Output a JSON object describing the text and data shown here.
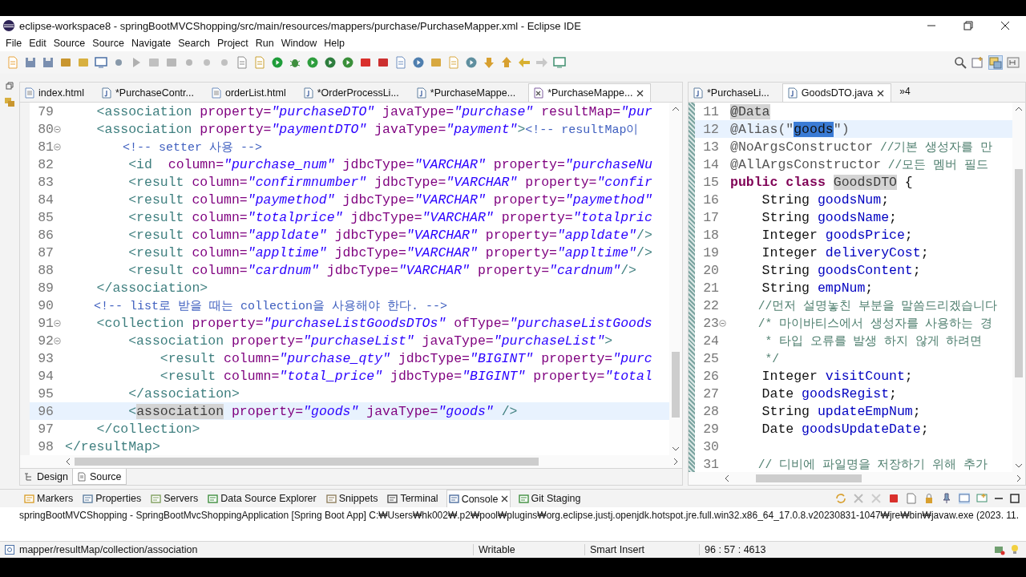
{
  "window": {
    "title": "eclipse-workspace8 - springBootMVCShopping/src/main/resources/mappers/purchase/PurchaseMapper.xml - Eclipse IDE"
  },
  "menu": [
    "File",
    "Edit",
    "Source",
    "Source",
    "Navigate",
    "Search",
    "Project",
    "Run",
    "Window",
    "Help"
  ],
  "editor_left": {
    "tabs": [
      {
        "label": "index.html",
        "kind": "html",
        "selected": false
      },
      {
        "label": "*PurchaseContr...",
        "kind": "java",
        "selected": false
      },
      {
        "label": "orderList.html",
        "kind": "html",
        "selected": false
      },
      {
        "label": "*OrderProcessLi...",
        "kind": "java",
        "selected": false
      },
      {
        "label": "*PurchaseMappe...",
        "kind": "java",
        "selected": false
      },
      {
        "label": "*PurchaseMappe...",
        "kind": "xml",
        "selected": true
      }
    ],
    "lines": [
      {
        "number": "79",
        "current": false,
        "fold": false,
        "tokens": [
          {
            "kind": "tag",
            "text": "    <association"
          },
          {
            "kind": "attr",
            "text": " property="
          },
          {
            "kind": "str",
            "text": "\"purchaseDTO\""
          },
          {
            "kind": "attr",
            "text": " javaType="
          },
          {
            "kind": "str",
            "text": "\"purchase\""
          },
          {
            "kind": "attr",
            "text": " resultMap="
          },
          {
            "kind": "str",
            "text": "\"pur"
          }
        ]
      },
      {
        "number": "80",
        "current": false,
        "fold": true,
        "tokens": [
          {
            "kind": "tag",
            "text": "    <association"
          },
          {
            "kind": "attr",
            "text": " property="
          },
          {
            "kind": "str",
            "text": "\"paymentDTO\""
          },
          {
            "kind": "attr",
            "text": " javaType="
          },
          {
            "kind": "str",
            "text": "\"payment\""
          },
          {
            "kind": "tag",
            "text": ">"
          },
          {
            "kind": "comment",
            "text": "<!-- resultMap이"
          }
        ]
      },
      {
        "number": "81",
        "current": false,
        "fold": true,
        "tokens": [
          {
            "kind": "comment",
            "text": "        <!-- setter 사용 -->"
          }
        ]
      },
      {
        "number": "82",
        "current": false,
        "fold": false,
        "tokens": [
          {
            "kind": "tag",
            "text": "        <id"
          },
          {
            "kind": "attr",
            "text": "  column="
          },
          {
            "kind": "str",
            "text": "\"purchase_num\""
          },
          {
            "kind": "attr",
            "text": " jdbcType="
          },
          {
            "kind": "str",
            "text": "\"VARCHAR\""
          },
          {
            "kind": "attr",
            "text": " property="
          },
          {
            "kind": "str",
            "text": "\"purchaseNu"
          }
        ]
      },
      {
        "number": "83",
        "current": false,
        "fold": false,
        "tokens": [
          {
            "kind": "tag",
            "text": "        <result"
          },
          {
            "kind": "attr",
            "text": " column="
          },
          {
            "kind": "str",
            "text": "\"confirmnumber\""
          },
          {
            "kind": "attr",
            "text": " jdbcType="
          },
          {
            "kind": "str",
            "text": "\"VARCHAR\""
          },
          {
            "kind": "attr",
            "text": " property="
          },
          {
            "kind": "str",
            "text": "\"confir"
          }
        ]
      },
      {
        "number": "84",
        "current": false,
        "fold": false,
        "tokens": [
          {
            "kind": "tag",
            "text": "        <result"
          },
          {
            "kind": "attr",
            "text": " column="
          },
          {
            "kind": "str",
            "text": "\"paymethod\""
          },
          {
            "kind": "attr",
            "text": " jdbcType="
          },
          {
            "kind": "str",
            "text": "\"VARCHAR\""
          },
          {
            "kind": "attr",
            "text": " property="
          },
          {
            "kind": "str",
            "text": "\"paymethod\""
          }
        ]
      },
      {
        "number": "85",
        "current": false,
        "fold": false,
        "tokens": [
          {
            "kind": "tag",
            "text": "        <result"
          },
          {
            "kind": "attr",
            "text": " column="
          },
          {
            "kind": "str",
            "text": "\"totalprice\""
          },
          {
            "kind": "attr",
            "text": " jdbcType="
          },
          {
            "kind": "str",
            "text": "\"VARCHAR\""
          },
          {
            "kind": "attr",
            "text": " property="
          },
          {
            "kind": "str",
            "text": "\"totalpric"
          }
        ]
      },
      {
        "number": "86",
        "current": false,
        "fold": false,
        "tokens": [
          {
            "kind": "tag",
            "text": "        <result"
          },
          {
            "kind": "attr",
            "text": " column="
          },
          {
            "kind": "str",
            "text": "\"appldate\""
          },
          {
            "kind": "attr",
            "text": " jdbcType="
          },
          {
            "kind": "str",
            "text": "\"VARCHAR\""
          },
          {
            "kind": "attr",
            "text": " property="
          },
          {
            "kind": "str",
            "text": "\"appldate\""
          },
          {
            "kind": "tag",
            "text": "/>"
          }
        ]
      },
      {
        "number": "87",
        "current": false,
        "fold": false,
        "tokens": [
          {
            "kind": "tag",
            "text": "        <result"
          },
          {
            "kind": "attr",
            "text": " column="
          },
          {
            "kind": "str",
            "text": "\"appltime\""
          },
          {
            "kind": "attr",
            "text": " jdbcType="
          },
          {
            "kind": "str",
            "text": "\"VARCHAR\""
          },
          {
            "kind": "attr",
            "text": " property="
          },
          {
            "kind": "str",
            "text": "\"appltime\""
          },
          {
            "kind": "tag",
            "text": "/>"
          }
        ]
      },
      {
        "number": "88",
        "current": false,
        "fold": false,
        "tokens": [
          {
            "kind": "tag",
            "text": "        <result"
          },
          {
            "kind": "attr",
            "text": " column="
          },
          {
            "kind": "str",
            "text": "\"cardnum\""
          },
          {
            "kind": "attr",
            "text": " jdbcType="
          },
          {
            "kind": "str",
            "text": "\"VARCHAR\""
          },
          {
            "kind": "attr",
            "text": " property="
          },
          {
            "kind": "str",
            "text": "\"cardnum\""
          },
          {
            "kind": "tag",
            "text": "/>"
          }
        ]
      },
      {
        "number": "89",
        "current": false,
        "fold": false,
        "tokens": [
          {
            "kind": "tag",
            "text": "    </association>"
          }
        ]
      },
      {
        "number": "90",
        "current": false,
        "fold": false,
        "tokens": [
          {
            "kind": "comment",
            "text": "    <!-- list로 받을 때는 collection을 사용해야 한다. -->"
          }
        ]
      },
      {
        "number": "91",
        "current": false,
        "fold": true,
        "tokens": [
          {
            "kind": "tag",
            "text": "    <collection"
          },
          {
            "kind": "attr",
            "text": " property="
          },
          {
            "kind": "str",
            "text": "\"purchaseListGoodsDTOs\""
          },
          {
            "kind": "attr",
            "text": " ofType="
          },
          {
            "kind": "str",
            "text": "\"purchaseListGoods"
          }
        ]
      },
      {
        "number": "92",
        "current": false,
        "fold": true,
        "tokens": [
          {
            "kind": "tag",
            "text": "        <association"
          },
          {
            "kind": "attr",
            "text": " property="
          },
          {
            "kind": "str",
            "text": "\"purchaseList\""
          },
          {
            "kind": "attr",
            "text": " javaType="
          },
          {
            "kind": "str",
            "text": "\"purchaseList\""
          },
          {
            "kind": "tag",
            "text": ">"
          }
        ]
      },
      {
        "number": "93",
        "current": false,
        "fold": false,
        "tokens": [
          {
            "kind": "tag",
            "text": "            <result"
          },
          {
            "kind": "attr",
            "text": " column="
          },
          {
            "kind": "str",
            "text": "\"purchase_qty\""
          },
          {
            "kind": "attr",
            "text": " jdbcType="
          },
          {
            "kind": "str",
            "text": "\"BIGINT\""
          },
          {
            "kind": "attr",
            "text": " property="
          },
          {
            "kind": "str",
            "text": "\"purc"
          }
        ]
      },
      {
        "number": "94",
        "current": false,
        "fold": false,
        "tokens": [
          {
            "kind": "tag",
            "text": "            <result"
          },
          {
            "kind": "attr",
            "text": " column="
          },
          {
            "kind": "str",
            "text": "\"total_price\""
          },
          {
            "kind": "attr",
            "text": " jdbcType="
          },
          {
            "kind": "str",
            "text": "\"BIGINT\""
          },
          {
            "kind": "attr",
            "text": " property="
          },
          {
            "kind": "str",
            "text": "\"total"
          }
        ]
      },
      {
        "number": "95",
        "current": false,
        "fold": false,
        "tokens": [
          {
            "kind": "tag",
            "text": "        </association>"
          }
        ]
      },
      {
        "number": "96",
        "current": true,
        "fold": false,
        "tokens": [
          {
            "kind": "tag",
            "text": "        <"
          },
          {
            "kind": "occurrence",
            "text": "association"
          },
          {
            "kind": "attr",
            "text": " property="
          },
          {
            "kind": "str",
            "text": "\"goods\""
          },
          {
            "kind": "attr",
            "text": " javaType="
          },
          {
            "kind": "str",
            "text": "\"goods\""
          },
          {
            "kind": "tag",
            "text": " />"
          }
        ]
      },
      {
        "number": "97",
        "current": false,
        "fold": false,
        "tokens": [
          {
            "kind": "tag",
            "text": "    </collection>"
          }
        ]
      },
      {
        "number": "98",
        "current": false,
        "fold": false,
        "tokens": [
          {
            "kind": "tag",
            "text": "</resultMap>"
          }
        ]
      }
    ],
    "view_tabs": [
      {
        "label": "Design",
        "selected": false
      },
      {
        "label": "Source",
        "selected": true
      }
    ]
  },
  "editor_right": {
    "tabs": [
      {
        "label": "*PurchaseLi...",
        "kind": "java",
        "selected": false
      },
      {
        "label": "GoodsDTO.java",
        "kind": "java",
        "selected": true
      }
    ],
    "overflow": "»4",
    "lines": [
      {
        "number": "11",
        "current": false,
        "fold": false,
        "tokens": [
          {
            "kind": "occurrence",
            "text": "@Data"
          }
        ]
      },
      {
        "number": "12",
        "current": true,
        "fold": false,
        "tokens": [
          {
            "kind": "annotation",
            "text": "@Alias(\""
          },
          {
            "kind": "selection",
            "text": "goods"
          },
          {
            "kind": "annotation",
            "text": "\")"
          }
        ]
      },
      {
        "number": "13",
        "current": false,
        "fold": false,
        "tokens": [
          {
            "kind": "annotation",
            "text": "@NoArgsConstructor"
          },
          {
            "kind": "jcomment",
            "text": " //기본 생성자를 만"
          }
        ]
      },
      {
        "number": "14",
        "current": false,
        "fold": false,
        "tokens": [
          {
            "kind": "annotation",
            "text": "@AllArgsConstructor"
          },
          {
            "kind": "jcomment",
            "text": " //모든 멤버 필드"
          }
        ]
      },
      {
        "number": "15",
        "current": false,
        "fold": false,
        "tokens": [
          {
            "kind": "keyword",
            "text": "public class "
          },
          {
            "kind": "occurrence",
            "text": "GoodsDTO"
          },
          {
            "kind": "plain",
            "text": " {"
          }
        ]
      },
      {
        "number": "16",
        "current": false,
        "fold": false,
        "tokens": [
          {
            "kind": "plain",
            "text": "    String"
          },
          {
            "kind": "field",
            "text": " goodsNum"
          },
          {
            "kind": "plain",
            "text": ";"
          }
        ]
      },
      {
        "number": "17",
        "current": false,
        "fold": false,
        "tokens": [
          {
            "kind": "plain",
            "text": "    String"
          },
          {
            "kind": "field",
            "text": " goodsName"
          },
          {
            "kind": "plain",
            "text": ";"
          }
        ]
      },
      {
        "number": "18",
        "current": false,
        "fold": false,
        "tokens": [
          {
            "kind": "plain",
            "text": "    Integer"
          },
          {
            "kind": "field",
            "text": " goodsPrice"
          },
          {
            "kind": "plain",
            "text": ";"
          }
        ]
      },
      {
        "number": "19",
        "current": false,
        "fold": false,
        "tokens": [
          {
            "kind": "plain",
            "text": "    Integer"
          },
          {
            "kind": "field",
            "text": " deliveryCost"
          },
          {
            "kind": "plain",
            "text": ";"
          }
        ]
      },
      {
        "number": "20",
        "current": false,
        "fold": false,
        "tokens": [
          {
            "kind": "plain",
            "text": "    String"
          },
          {
            "kind": "field",
            "text": " goodsContent"
          },
          {
            "kind": "plain",
            "text": ";"
          }
        ]
      },
      {
        "number": "21",
        "current": false,
        "fold": false,
        "tokens": [
          {
            "kind": "plain",
            "text": "    String"
          },
          {
            "kind": "field",
            "text": " empNum"
          },
          {
            "kind": "plain",
            "text": ";"
          }
        ]
      },
      {
        "number": "22",
        "current": false,
        "fold": false,
        "tokens": [
          {
            "kind": "jcomment",
            "text": "    //먼저 설명놓친 부분을 말씀드리겠습니다"
          }
        ]
      },
      {
        "number": "23",
        "current": false,
        "fold": true,
        "tokens": [
          {
            "kind": "jcomment",
            "text": "    /* 마이바티스에서 생성자를 사용하는 경"
          }
        ]
      },
      {
        "number": "24",
        "current": false,
        "fold": false,
        "tokens": [
          {
            "kind": "jcomment",
            "text": "     * 타입 오류를 발생 하지 않게 하려면"
          }
        ]
      },
      {
        "number": "25",
        "current": false,
        "fold": false,
        "tokens": [
          {
            "kind": "jcomment",
            "text": "     */"
          }
        ]
      },
      {
        "number": "26",
        "current": false,
        "fold": false,
        "tokens": [
          {
            "kind": "plain",
            "text": "    Integer"
          },
          {
            "kind": "field",
            "text": " visitCount"
          },
          {
            "kind": "plain",
            "text": ";"
          }
        ]
      },
      {
        "number": "27",
        "current": false,
        "fold": false,
        "tokens": [
          {
            "kind": "plain",
            "text": "    Date"
          },
          {
            "kind": "field",
            "text": " goodsRegist"
          },
          {
            "kind": "plain",
            "text": ";"
          }
        ]
      },
      {
        "number": "28",
        "current": false,
        "fold": false,
        "tokens": [
          {
            "kind": "plain",
            "text": "    String"
          },
          {
            "kind": "field",
            "text": " updateEmpNum"
          },
          {
            "kind": "plain",
            "text": ";"
          }
        ]
      },
      {
        "number": "29",
        "current": false,
        "fold": false,
        "tokens": [
          {
            "kind": "plain",
            "text": "    Date"
          },
          {
            "kind": "field",
            "text": " goodsUpdateDate"
          },
          {
            "kind": "plain",
            "text": ";"
          }
        ]
      },
      {
        "number": "30",
        "current": false,
        "fold": false
      },
      {
        "number": "31",
        "current": false,
        "fold": false,
        "tokens": [
          {
            "kind": "jcomment",
            "text": "    // 디비에 파일명을 저장하기 위해 추가"
          }
        ]
      }
    ]
  },
  "panel": {
    "tabs": [
      {
        "label": "Markers",
        "selected": false
      },
      {
        "label": "Properties",
        "selected": false
      },
      {
        "label": "Servers",
        "selected": false
      },
      {
        "label": "Data Source Explorer",
        "selected": false
      },
      {
        "label": "Snippets",
        "selected": false
      },
      {
        "label": "Terminal",
        "selected": false
      },
      {
        "label": "Console",
        "selected": true
      },
      {
        "label": "Git Staging",
        "selected": false
      }
    ],
    "console_text": "springBootMVCShopping - SpringBootMvcShoppingApplication [Spring Boot App] C:₩Users₩hk002₩.p2₩pool₩plugins₩org.eclipse.justj.openjdk.hotspot.jre.full.win32.x86_64_17.0.8.v20230831-1047₩jre₩bin₩javaw.exe  (2023. 11."
  },
  "status_bar": {
    "path": "mapper/resultMap/collection/association",
    "mode": "Writable",
    "insert": "Smart Insert",
    "position": "96 : 57 : 4613"
  }
}
